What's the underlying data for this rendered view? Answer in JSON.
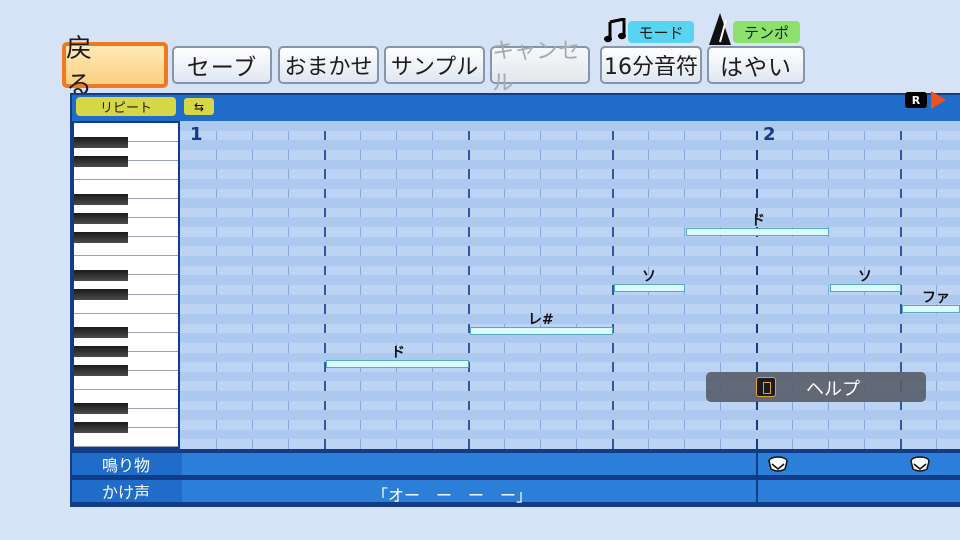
{
  "toolbar": {
    "back_label": "戻　る",
    "save_label": "セーブ",
    "auto_label": "おまかせ",
    "sample_label": "サンプル",
    "cancel_label": "キャンセル",
    "note_value": "16分音符",
    "tempo_value": "はやい",
    "mode_tag": "モード",
    "tempo_tag": "テンポ"
  },
  "editor": {
    "repeat_label": "リピート",
    "repeat_icon": "⇆",
    "rec_label": "R",
    "measures": [
      "1",
      "2"
    ],
    "notes": [
      {
        "label": "ド"
      },
      {
        "label": "レ#"
      },
      {
        "label": "ソ"
      },
      {
        "label": "ド"
      },
      {
        "label": "ソ"
      },
      {
        "label": "ファ"
      }
    ]
  },
  "help": {
    "label": "ヘルプ"
  },
  "tracks": {
    "percussion_label": "鳴り物",
    "chant_label": "かけ声",
    "chant_text": "「オー　ー　ー　ー」"
  },
  "colors": {
    "accent": "#ee7a20",
    "editor_frame": "#123d86",
    "grid_bg": "#bcd3f3",
    "note": "#d9fbff"
  },
  "icons": [
    "music-note-icon",
    "metronome-icon",
    "repeat-icon",
    "record-icon",
    "play-icon",
    "controller-button-icon",
    "drum-icon"
  ]
}
